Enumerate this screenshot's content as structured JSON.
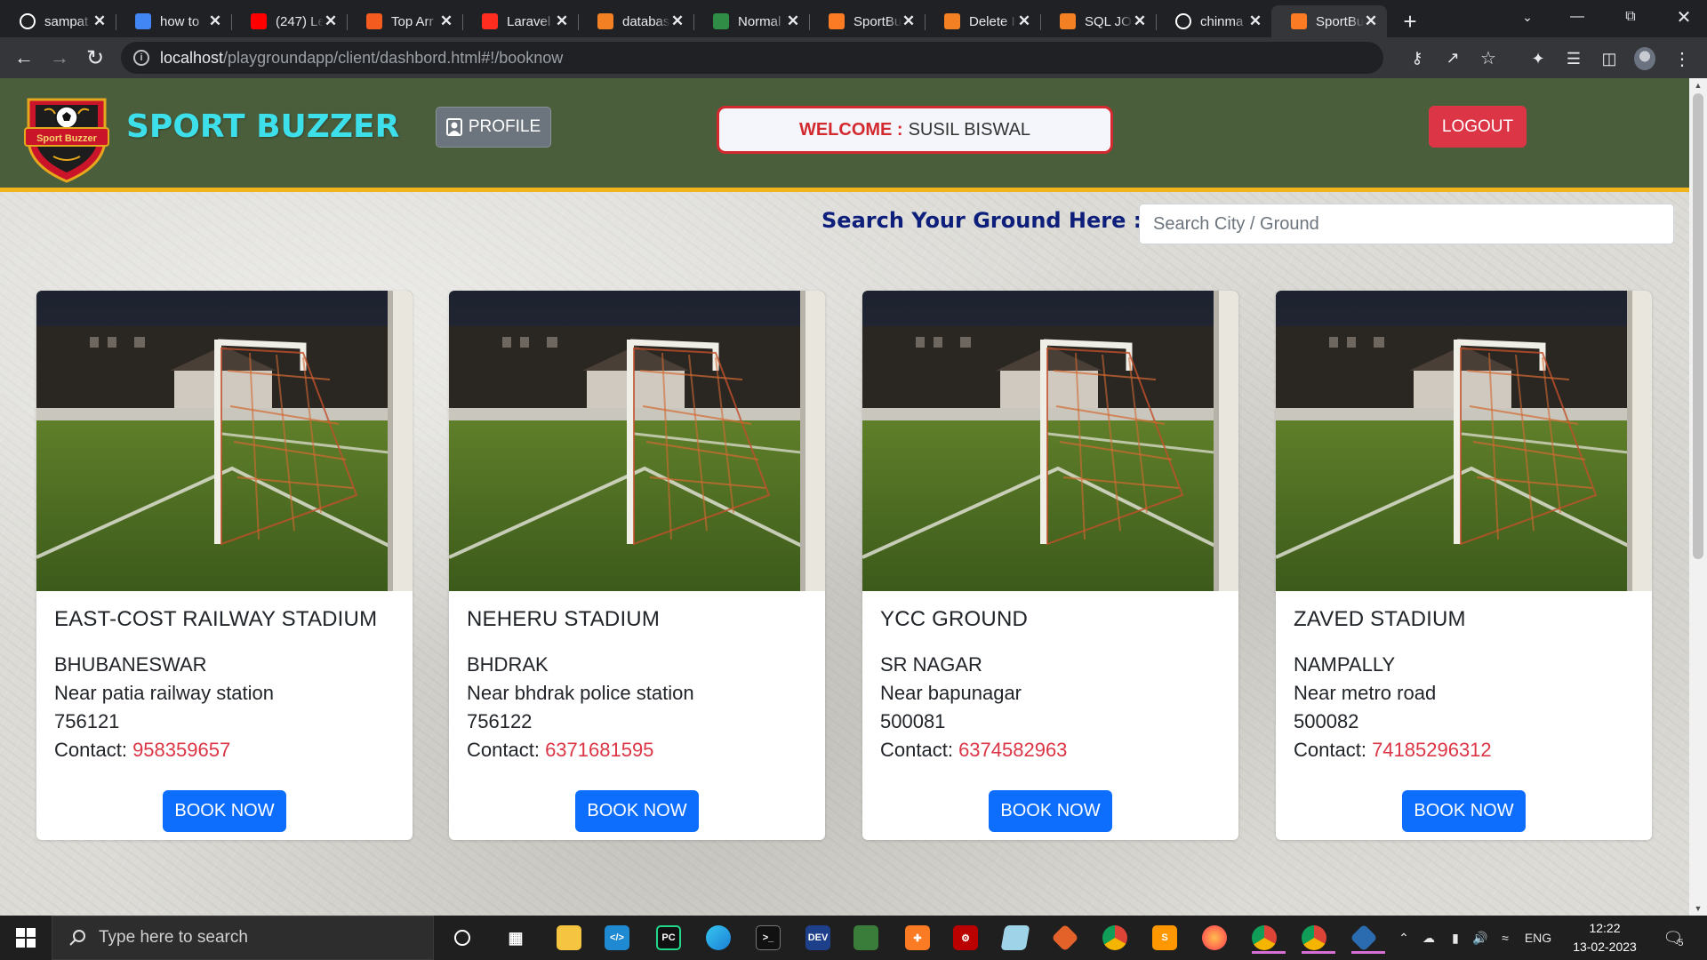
{
  "browser": {
    "tabs": [
      {
        "title": "sampat",
        "icon": "github-icon",
        "color": "#ffffff",
        "active": false
      },
      {
        "title": "how to",
        "icon": "google-icon",
        "color": "#4285f4",
        "active": false
      },
      {
        "title": "(247) Le",
        "icon": "youtube-icon",
        "color": "#ff0000",
        "active": false
      },
      {
        "title": "Top Arr",
        "icon": "codecamp-icon",
        "color": "#f45b1f",
        "active": false
      },
      {
        "title": "Laravel",
        "icon": "laravel-icon",
        "color": "#ff2d20",
        "active": false
      },
      {
        "title": "databas",
        "icon": "stackoverflow-icon",
        "color": "#f48024",
        "active": false
      },
      {
        "title": "Normal",
        "icon": "gfg-icon",
        "color": "#2f8d46",
        "active": false
      },
      {
        "title": "SportBu",
        "icon": "xampp-icon",
        "color": "#fb7a24",
        "active": false
      },
      {
        "title": "Delete I",
        "icon": "stackoverflow-icon",
        "color": "#f48024",
        "active": false
      },
      {
        "title": "SQL JO",
        "icon": "stackoverflow-icon",
        "color": "#f48024",
        "active": false
      },
      {
        "title": "chinma",
        "icon": "github-icon",
        "color": "#ffffff",
        "active": false
      },
      {
        "title": "SportBu",
        "icon": "xampp-icon",
        "color": "#fb7a24",
        "active": true
      }
    ],
    "url_host": "localhost",
    "url_path": "/playgroundapp/client/dashbord.html#!/booknow"
  },
  "page": {
    "brand": "SPORT BUZZER",
    "logo_text": "Sport Buzzer",
    "profile_label": "PROFILE",
    "welcome_label": "WELCOME :",
    "welcome_name": "SUSIL BISWAL",
    "logout_label": "LOGOUT",
    "search_label": "Search Your Ground Here :",
    "search_placeholder": "Search City / Ground",
    "contact_label": "Contact:",
    "book_label": "BOOK NOW",
    "grounds": [
      {
        "name": "EAST-COST RAILWAY STADIUM",
        "city": "BHUBANESWAR",
        "landmark": "Near patia railway station",
        "pin": "756121",
        "contact": "958359657"
      },
      {
        "name": "NEHERU STADIUM",
        "city": "BHDRAK",
        "landmark": "Near bhdrak police station",
        "pin": "756122",
        "contact": "6371681595"
      },
      {
        "name": "YCC GROUND",
        "city": "SR NAGAR",
        "landmark": "Near bapunagar",
        "pin": "500081",
        "contact": "6374582963"
      },
      {
        "name": "ZAVED STADIUM",
        "city": "NAMPALLY",
        "landmark": "Near metro road",
        "pin": "500082",
        "contact": "74185296312"
      }
    ]
  },
  "taskbar": {
    "search_placeholder": "Type here to search",
    "language": "ENG",
    "time": "12:22",
    "date": "13-02-2023",
    "notification_count": "5"
  },
  "colors": {
    "header_bg": "#4a5e3c",
    "header_border": "#f0b41c",
    "brand": "#3de0ea",
    "danger": "#dc3545",
    "primary": "#0d6efd",
    "search_label": "#0d1f7a"
  }
}
